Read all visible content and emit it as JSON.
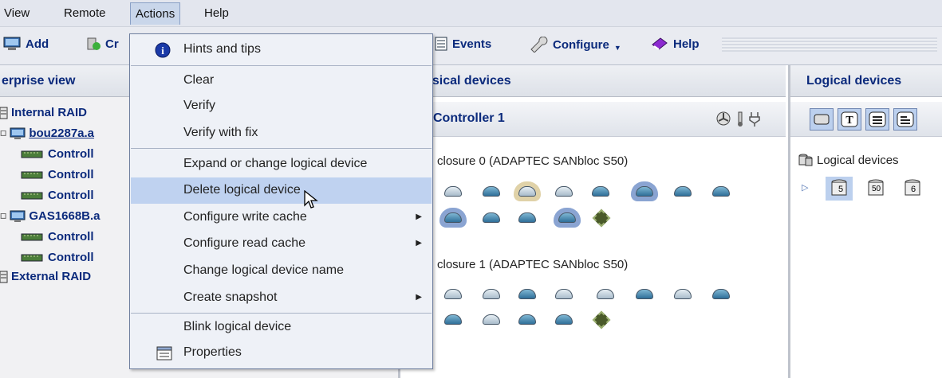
{
  "menubar": {
    "items": [
      "View",
      "Remote",
      "Actions",
      "Help"
    ]
  },
  "toolbar": {
    "add": "Add",
    "create_partial": "Cr",
    "events": "Events",
    "configure": "Configure",
    "help": "Help"
  },
  "left_pane": {
    "header": "erprise view",
    "tree": [
      "Internal RAID",
      "bou2287a.a",
      "Controll",
      "Controll",
      "Controll",
      "GAS1668B.a",
      "Controll",
      "Controll",
      "External RAID"
    ]
  },
  "middle_pane": {
    "header": "ysical devices",
    "controller_label": "Controller 1",
    "enclosure0": "closure 0 (ADAPTEC SANbloc S50)",
    "enclosure1": "closure 1 (ADAPTEC SANbloc S50)"
  },
  "right_pane": {
    "header": "Logical devices",
    "tree_label": "Logical devices",
    "device_numbers": [
      "5",
      "50",
      "6"
    ]
  },
  "actions_menu": {
    "items": [
      {
        "label": "Hints and tips",
        "icon": "info-icon"
      },
      {
        "label": "Clear"
      },
      {
        "label": "Verify"
      },
      {
        "label": "Verify with fix"
      },
      {
        "label": "Expand or change logical device"
      },
      {
        "label": "Delete logical device",
        "selected": true
      },
      {
        "label": "Configure write cache",
        "submenu": true
      },
      {
        "label": "Configure read cache",
        "submenu": true
      },
      {
        "label": "Change logical device name"
      },
      {
        "label": "Create snapshot",
        "submenu": true
      },
      {
        "label": "Blink logical device"
      },
      {
        "label": "Properties",
        "icon": "properties-icon"
      }
    ]
  },
  "colors": {
    "accent_text": "#0b2a7c",
    "menu_selection": "#bfd2f0",
    "menubar_bg": "#e3e6ee"
  }
}
